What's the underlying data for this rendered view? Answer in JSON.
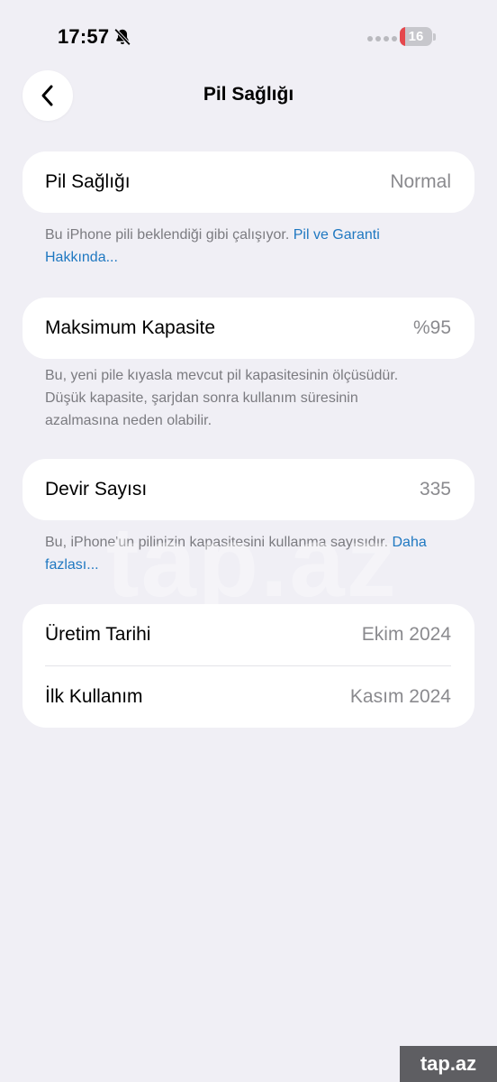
{
  "status_bar": {
    "time": "17:57",
    "battery_level": "16",
    "battery_fraction": 0.16,
    "bell_icon": "bell-slash-icon",
    "colors": {
      "battery_low": "#e5484d",
      "link": "#1f78c1"
    }
  },
  "header": {
    "back_icon": "chevron-left-icon",
    "title": "Pil Sağlığı"
  },
  "battery_health": {
    "label": "Pil Sağlığı",
    "value": "Normal",
    "footnote_text": "Bu iPhone pili beklendiği gibi çalışıyor. ",
    "footnote_link": "Pil ve Garanti Hakkında..."
  },
  "max_capacity": {
    "label": "Maksimum Kapasite",
    "value": "%95",
    "footnote_text": "Bu, yeni pile kıyasla mevcut pil kapasitesinin ölçüsüdür. Düşük kapasite, şarjdan sonra kullanım süresinin azalmasına neden olabilir."
  },
  "cycle_count": {
    "label": "Devir Sayısı",
    "value": "335",
    "footnote_text": "Bu, iPhone'un pilinizin kapasitesini kullanma sayısıdır. ",
    "footnote_link": "Daha fazlası..."
  },
  "dates": {
    "manufacture_label": "Üretim Tarihi",
    "manufacture_value": "Ekim 2024",
    "first_use_label": "İlk Kullanım",
    "first_use_value": "Kasım 2024"
  },
  "watermark": {
    "corner_text": "tap.az",
    "ghost_text": "tap.az"
  }
}
